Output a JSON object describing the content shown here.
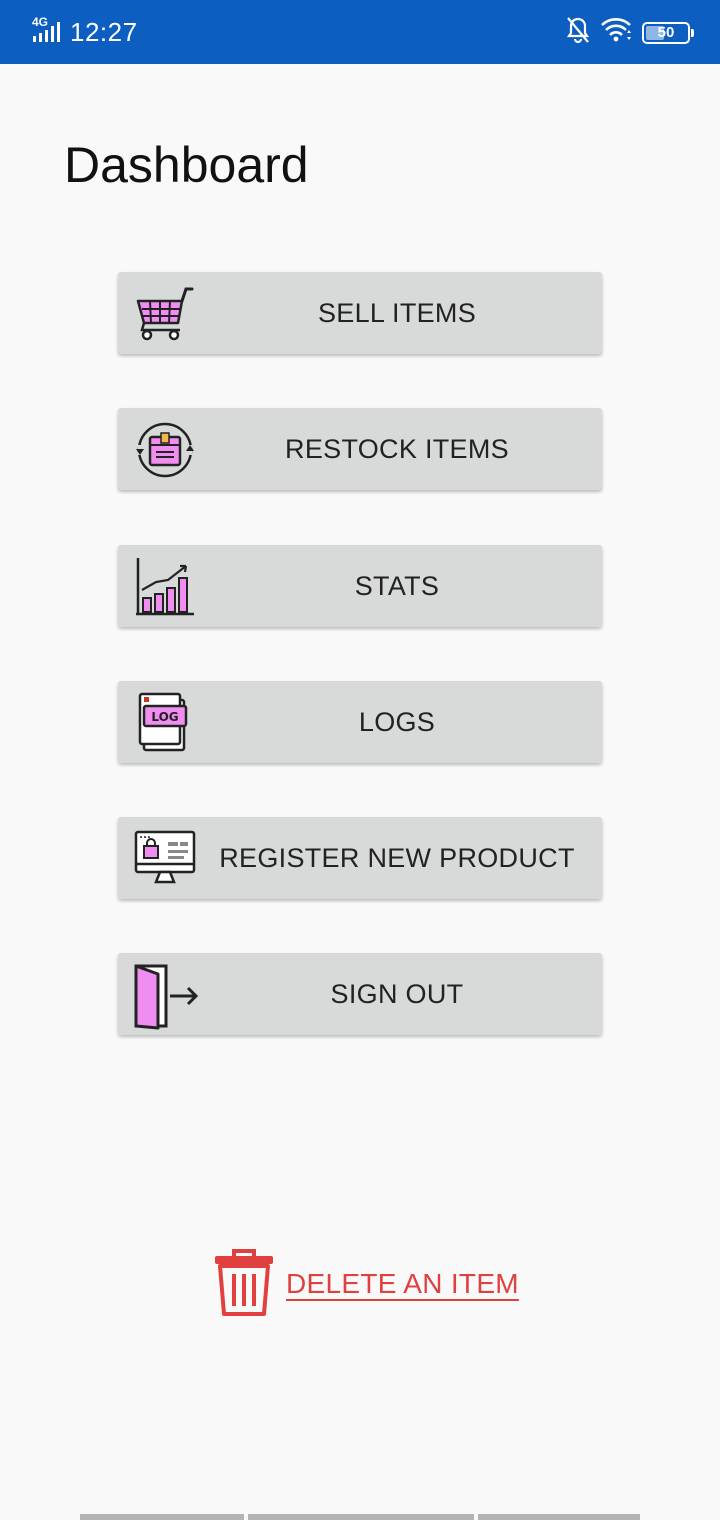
{
  "status_bar": {
    "network": "4G",
    "time": "12:27",
    "battery": "50"
  },
  "page": {
    "title": "Dashboard"
  },
  "menu": [
    {
      "label": "SELL ITEMS",
      "icon": "shopping-cart-icon"
    },
    {
      "label": "RESTOCK ITEMS",
      "icon": "restock-box-icon"
    },
    {
      "label": "STATS",
      "icon": "bar-chart-icon"
    },
    {
      "label": "LOGS",
      "icon": "log-file-icon"
    },
    {
      "label": "REGISTER NEW PRODUCT",
      "icon": "product-monitor-icon"
    },
    {
      "label": "SIGN OUT",
      "icon": "sign-out-door-icon"
    }
  ],
  "delete": {
    "label": "DELETE AN ITEM",
    "icon": "trash-icon"
  },
  "colors": {
    "status_bar": "#0c5ec1",
    "button_bg": "#d8d9d9",
    "icon_accent": "#ef8ef0",
    "danger": "#e0413f"
  }
}
